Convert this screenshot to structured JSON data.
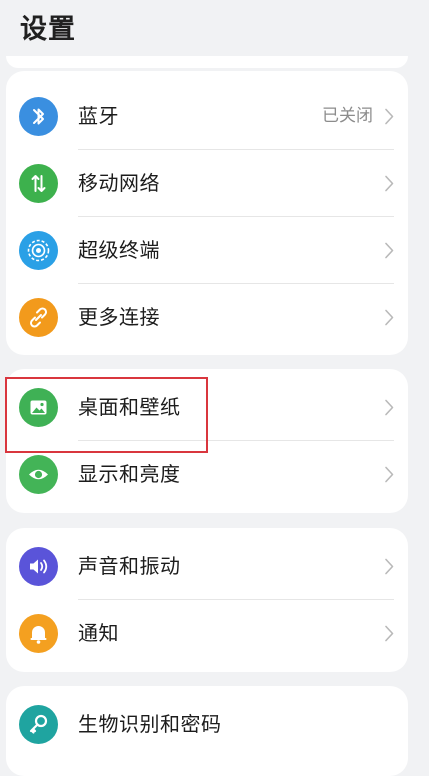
{
  "page": {
    "title": "设置"
  },
  "sections": [
    {
      "items": [
        {
          "label": "蓝牙",
          "value": "已关闭",
          "icon": "bluetooth-icon",
          "color": "#3a8fe0"
        },
        {
          "label": "移动网络",
          "value": "",
          "icon": "mobile-network-icon",
          "color": "#3db14d"
        },
        {
          "label": "超级终端",
          "value": "",
          "icon": "super-device-icon",
          "color": "#2aa0e6"
        },
        {
          "label": "更多连接",
          "value": "",
          "icon": "more-connections-icon",
          "color": "#f29a1c"
        }
      ]
    },
    {
      "items": [
        {
          "label": "桌面和壁纸",
          "value": "",
          "icon": "wallpaper-icon",
          "color": "#3fb155"
        },
        {
          "label": "显示和亮度",
          "value": "",
          "icon": "eye-icon",
          "color": "#43b457"
        }
      ]
    },
    {
      "items": [
        {
          "label": "声音和振动",
          "value": "",
          "icon": "sound-icon",
          "color": "#5a54d9"
        },
        {
          "label": "通知",
          "value": "",
          "icon": "bell-icon",
          "color": "#f4a020"
        }
      ]
    },
    {
      "items": [
        {
          "label": "生物识别和密码",
          "value": "",
          "icon": "key-icon",
          "color": "#1fa4a0"
        }
      ]
    }
  ],
  "colors": {
    "highlight": "#d9363e",
    "background": "#f1f2f4"
  }
}
